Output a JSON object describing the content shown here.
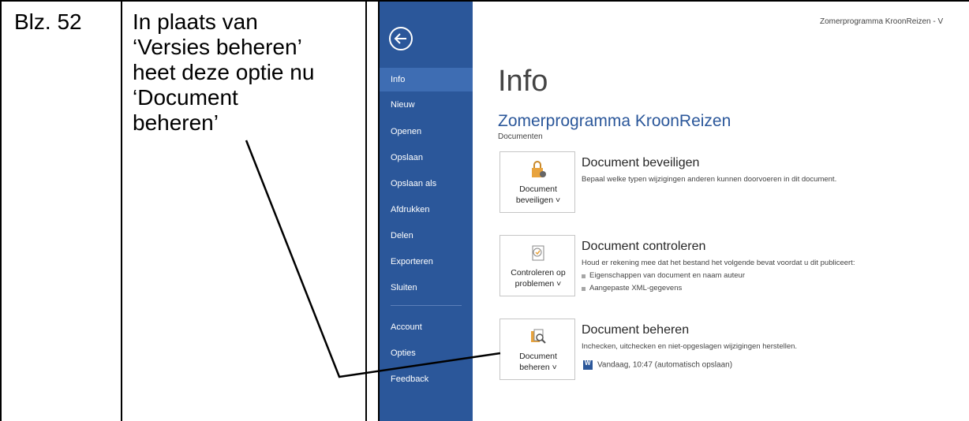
{
  "table": {
    "page_ref": "Blz. 52",
    "note_lines": [
      "In plaats van",
      "‘Versies beheren’",
      "heet deze optie nu",
      "‘Document",
      "beheren’"
    ]
  },
  "screenshot": {
    "window_title": "Zomerprogramma KroonReizen - V",
    "sidebar": {
      "items": [
        {
          "label": "Info",
          "active": true
        },
        {
          "label": "Nieuw"
        },
        {
          "label": "Openen"
        },
        {
          "label": "Opslaan"
        },
        {
          "label": "Opslaan als"
        },
        {
          "label": "Afdrukken"
        },
        {
          "label": "Delen"
        },
        {
          "label": "Exporteren"
        },
        {
          "label": "Sluiten"
        },
        {
          "label": "Account"
        },
        {
          "label": "Opties"
        },
        {
          "label": "Feedback"
        }
      ]
    },
    "page_title": "Info",
    "doc_name": "Zomerprogramma KroonReizen",
    "doc_location": "Documenten",
    "sections": [
      {
        "button_line1": "Document",
        "button_line2": "beveiligen ˅",
        "title": "Document beveiligen",
        "desc": "Bepaal welke typen wijzigingen anderen kunnen doorvoeren in dit document."
      },
      {
        "button_line1": "Controleren op",
        "button_line2": "problemen ˅",
        "title": "Document controleren",
        "desc": "Houd er rekening mee dat het bestand het volgende bevat voordat u dit publiceert:",
        "bullets": [
          "Eigenschappen van document en naam auteur",
          "Aangepaste XML-gegevens"
        ]
      },
      {
        "button_line1": "Document",
        "button_line2": "beheren ˅",
        "title": "Document beheren",
        "desc": "Inchecken, uitchecken en niet-opgeslagen wijzigingen herstellen.",
        "version": "Vandaag, 10:47 (automatisch opslaan)"
      }
    ]
  }
}
